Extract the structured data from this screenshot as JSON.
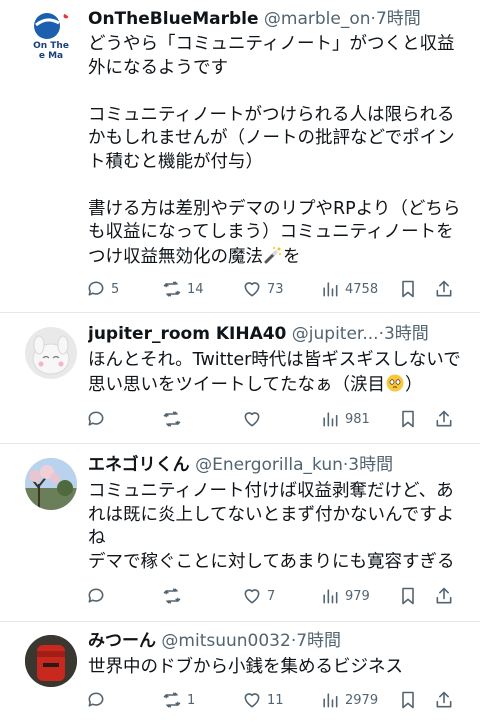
{
  "tweets": [
    {
      "name": "OnTheBlueMarble",
      "handle": "@marble_on",
      "sep": "·",
      "time": "7時間",
      "avatar_text": [
        "On The",
        "e Ma"
      ],
      "body": "どうやら「コミュニティノート」がつくと収益外になるようです\n\nコミュニティノートがつけられる人は限られるかもしれませんが（ノートの批評などでポイント積むと機能が付与）\n\n書ける方は差別やデマのリプやRPより（どちらも収益になってしまう）コミュニティノートをつけ収益無効化の魔法",
      "body_tail": "を",
      "replies": "5",
      "retweets": "14",
      "likes": "73",
      "views": "4758"
    },
    {
      "name": "jupiter_room KIHA40",
      "handle": "@jupiter...",
      "sep": "·",
      "time": "3時間",
      "body": "ほんとそれ。Twitter時代は皆ギスギスしないで思い思いをツイートしてたなぁ（涙目",
      "body_tail": "）",
      "replies": "",
      "retweets": "",
      "likes": "",
      "views": "981"
    },
    {
      "name": "エネゴリくん",
      "handle": "@Energorilla_kun",
      "sep": "·",
      "time": "3時間",
      "body": "コミュニティノート付けば収益剥奪だけど、あれは既に炎上してないとまず付かないんですよね\nデマで稼ぐことに対してあまりにも寛容すぎる",
      "replies": "",
      "retweets": "",
      "likes": "7",
      "views": "979"
    },
    {
      "name": "みつーん",
      "handle": "@mitsuun0032",
      "sep": "·",
      "time": "7時間",
      "body": "世界中のドブから小銭を集めるビジネス",
      "replies": "",
      "retweets": "1",
      "likes": "11",
      "views": "2979"
    }
  ]
}
